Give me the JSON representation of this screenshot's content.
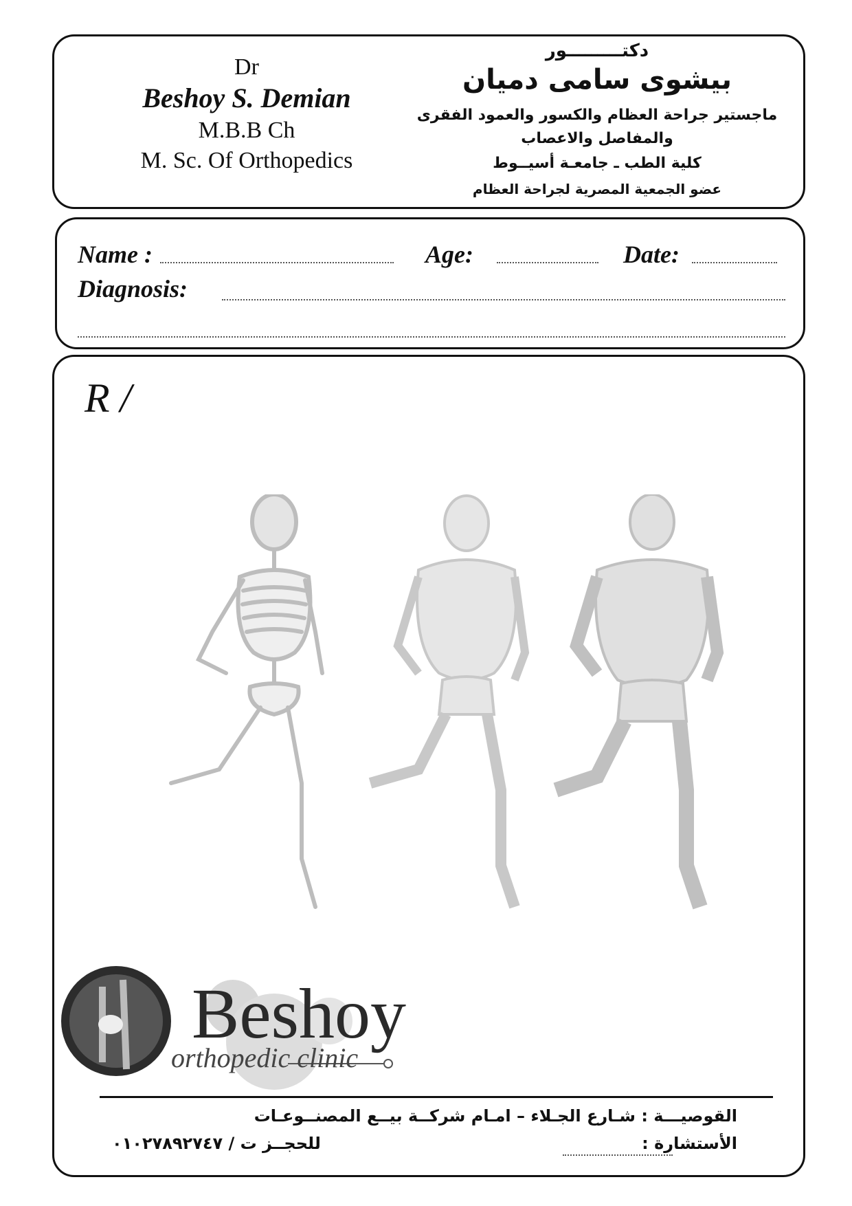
{
  "header": {
    "en_title": "Dr",
    "en_name": "Beshoy S. Demian",
    "en_degree": "M.B.B Ch",
    "en_msc": "M. Sc. Of Orthopedics",
    "ar_title": "دكتـــــــــور",
    "ar_name": "بيشوى سامى دميان",
    "ar_line1": "ماجستير جراحة العظام والكسور والعمود الفقرى",
    "ar_line2": "والمفاصل والاعصاب",
    "ar_line3": "كلية الطب ـ جامعـة أسيــوط",
    "ar_line4": "عضو الجمعية المصرية لجراحة العظام"
  },
  "patient": {
    "name_label": "Name :",
    "age_label": "Age:",
    "date_label": "Date:",
    "diagnosis_label": "Diagnosis:"
  },
  "rx": {
    "symbol": "R /"
  },
  "logo": {
    "word": "Beshoy",
    "subtitle": "orthopedic clinic"
  },
  "footer": {
    "address": "القوصيـــة : شـارع الجـلاء – امـام شركــة بيــع المصنــوعـات",
    "consult": "الأستشارة : ",
    "booking": "للحجــز ت / ٠١٠٢٧٨٩٢٧٤٧"
  }
}
